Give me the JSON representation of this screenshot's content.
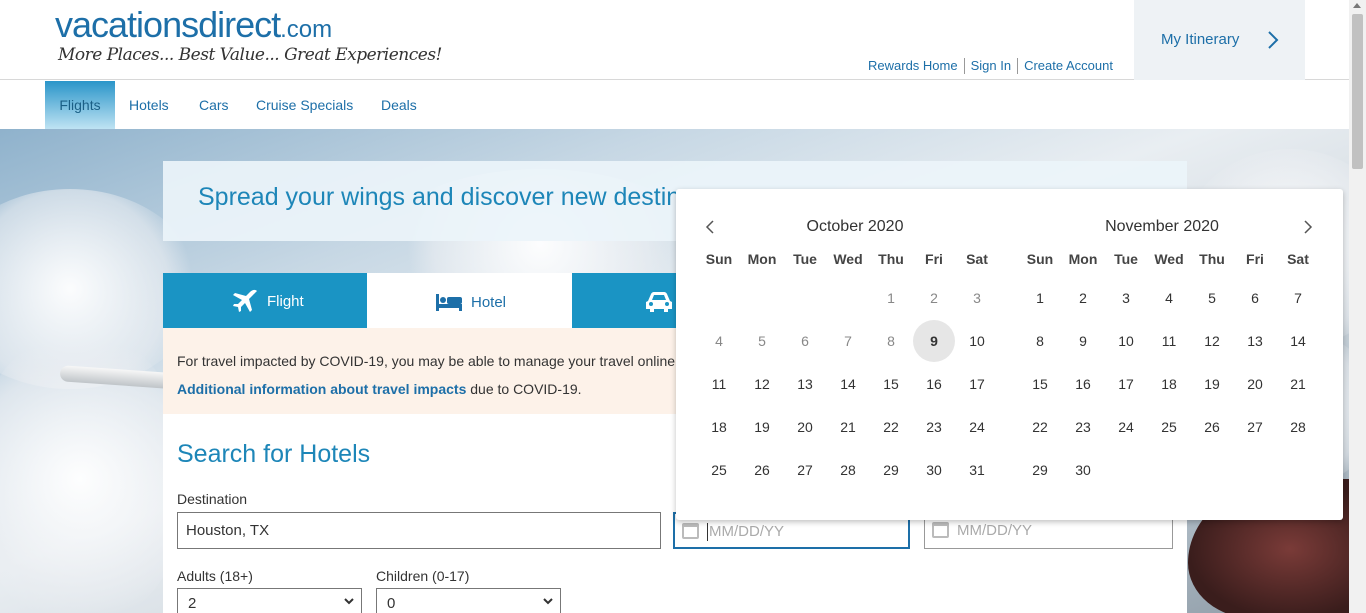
{
  "brand": {
    "name": "vacationsdirect",
    "tld": ".com",
    "tagline": "More Places... Best Value... Great Experiences!",
    "accent_color": "#1d6fa8"
  },
  "header": {
    "links": [
      "Rewards Home",
      "Sign In",
      "Create Account"
    ],
    "itinerary_label": "My Itinerary"
  },
  "nav": {
    "items": [
      "Flights",
      "Hotels",
      "Cars",
      "Cruise Specials",
      "Deals"
    ],
    "active": "Flights"
  },
  "banner": {
    "text": "Spread your wings and discover new destinations"
  },
  "tabs": [
    {
      "label": "Flight",
      "icon": "plane-icon"
    },
    {
      "label": "Hotel",
      "icon": "bed-icon"
    },
    {
      "label": "",
      "icon": "car-icon"
    }
  ],
  "covid": {
    "line1": "For travel impacted by COVID-19, you may be able to manage your travel online",
    "link": "Additional information about travel impacts",
    "line2_suffix": " due to COVID-19."
  },
  "search": {
    "title": "Search for Hotels",
    "destination_label": "Destination",
    "destination_value": "Houston, TX",
    "checkin_placeholder": "MM/DD/YY",
    "checkout_placeholder": "MM/DD/YY",
    "adults_label": "Adults (18+)",
    "adults_value": "2",
    "children_label": "Children (0-17)",
    "children_value": "0"
  },
  "datepicker": {
    "weekdays": [
      "Sun",
      "Mon",
      "Tue",
      "Wed",
      "Thu",
      "Fri",
      "Sat"
    ],
    "months": [
      {
        "title": "October 2020",
        "first_weekday": 4,
        "days": 31,
        "past_before": 9,
        "today": 9
      },
      {
        "title": "November 2020",
        "first_weekday": 0,
        "days": 30,
        "past_before": 0,
        "today": null
      }
    ]
  }
}
